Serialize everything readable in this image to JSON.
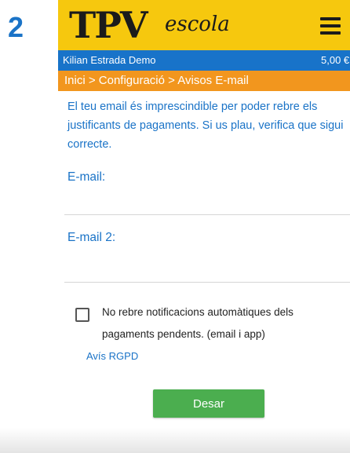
{
  "step_number": "2",
  "header": {
    "logo_main": "TPV",
    "logo_script": "escola",
    "menu_icon": "hamburger-menu-icon",
    "bg_color": "#f6c80e"
  },
  "user_bar": {
    "user_name": "Kilian Estrada Demo",
    "balance": "5,00 €",
    "bg_color": "#1873c9"
  },
  "breadcrumb": {
    "text": "Inici > Configuració > Avisos E-mail",
    "bg_color": "#f2961e"
  },
  "form": {
    "intro_text": "El teu email és imprescindible per poder rebre els justificants de pagaments. Si us plau, verifica que sigui correcte.",
    "email_label": "E-mail:",
    "email_value": "",
    "email2_label": "E-mail 2:",
    "email2_value": "",
    "opt_out_checked": false,
    "opt_out_label": "No rebre notificacions automàtiques dels pagaments pendents. (email i app)",
    "rgpd_link": "Avís RGPD",
    "save_label": "Desar",
    "save_color": "#4bae4f"
  }
}
